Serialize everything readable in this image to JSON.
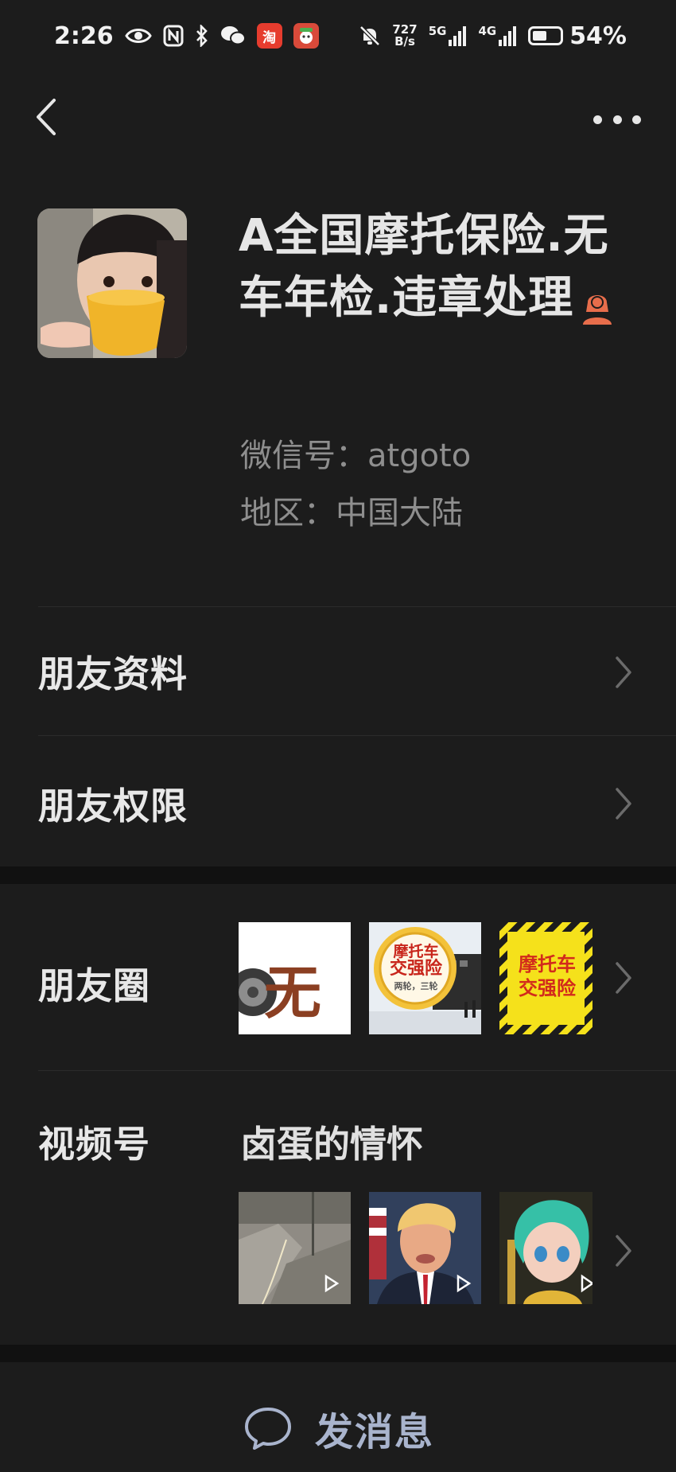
{
  "status_bar": {
    "time": "2:26",
    "net_speed_top": "727",
    "net_speed_bottom": "B/s",
    "signal1": "5G",
    "signal2": "4G",
    "battery": "54%",
    "battery_level": 0.54,
    "taobao_glyph": "淘"
  },
  "nav": {
    "back_icon": "chevron-left-icon",
    "more_icon": "more-dots-icon"
  },
  "profile": {
    "nickname": "A全国摩托保险.无车年检.违章处理",
    "gender_icon": "female-icon",
    "wechat_id": "微信号：atgoto",
    "region": "地区：中国大陆"
  },
  "rows": {
    "friend_info": "朋友资料",
    "friend_permissions": "朋友权限",
    "moments": "朋友圈",
    "channels": "视频号"
  },
  "moments_thumbs": [
    {
      "text": "无车"
    },
    {
      "line1": "摩托车",
      "line2": "交强险",
      "line3": "两轮，三轮"
    },
    {
      "line1": "摩托车",
      "line2": "交强险"
    }
  ],
  "channels_section": {
    "channel_name": "卤蛋的情怀"
  },
  "bottom": {
    "send_message": "发消息",
    "icon": "chat-bubble-icon"
  },
  "colors": {
    "background": "#1c1c1c",
    "accent_link": "#a9b4cd",
    "gender_icon": "#e76d4b"
  }
}
